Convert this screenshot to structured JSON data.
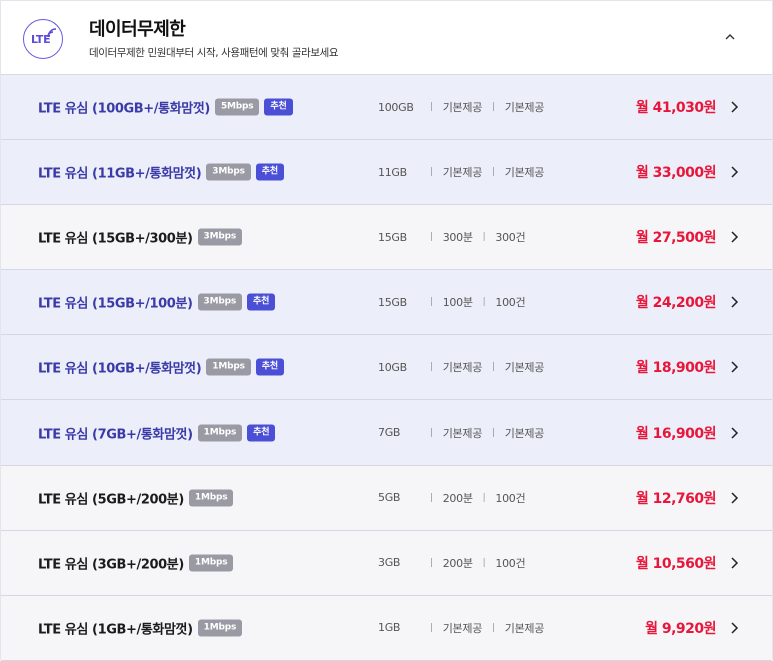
{
  "header": {
    "badge": "LTE",
    "title": "데이터무제한",
    "subtitle": "데이터무제한 민원대부터 시작, 사용패턴에 맞춰 골라보세요"
  },
  "colors": {
    "accent": "#4a4fd6",
    "price": "#e8163a",
    "highlight_row": "#eceff9",
    "plain_row": "#f6f6f9"
  },
  "plans": [
    {
      "name": "LTE 유심 (100GB+/통화맘껏)",
      "speed": "5Mbps",
      "badge": "추천",
      "data": "100GB",
      "voice": "기본제공",
      "sms": "기본제공",
      "price": "월 41,030원"
    },
    {
      "name": "LTE 유심 (11GB+/통화맘껏)",
      "speed": "3Mbps",
      "badge": "추천",
      "data": "11GB",
      "voice": "기본제공",
      "sms": "기본제공",
      "price": "월 33,000원"
    },
    {
      "name": "LTE 유심 (15GB+/300분)",
      "speed": "3Mbps",
      "badge": "",
      "data": "15GB",
      "voice": "300분",
      "sms": "300건",
      "price": "월 27,500원"
    },
    {
      "name": "LTE 유심 (15GB+/100분)",
      "speed": "3Mbps",
      "badge": "추천",
      "data": "15GB",
      "voice": "100분",
      "sms": "100건",
      "price": "월 24,200원"
    },
    {
      "name": "LTE 유심 (10GB+/통화맘껏)",
      "speed": "1Mbps",
      "badge": "추천",
      "data": "10GB",
      "voice": "기본제공",
      "sms": "기본제공",
      "price": "월 18,900원"
    },
    {
      "name": "LTE 유심 (7GB+/통화맘껏)",
      "speed": "1Mbps",
      "badge": "추천",
      "data": "7GB",
      "voice": "기본제공",
      "sms": "기본제공",
      "price": "월 16,900원"
    },
    {
      "name": "LTE 유심 (5GB+/200분)",
      "speed": "1Mbps",
      "badge": "",
      "data": "5GB",
      "voice": "200분",
      "sms": "100건",
      "price": "월 12,760원"
    },
    {
      "name": "LTE 유심 (3GB+/200분)",
      "speed": "1Mbps",
      "badge": "",
      "data": "3GB",
      "voice": "200분",
      "sms": "100건",
      "price": "월 10,560원"
    },
    {
      "name": "LTE 유심 (1GB+/통화맘껏)",
      "speed": "1Mbps",
      "badge": "",
      "data": "1GB",
      "voice": "기본제공",
      "sms": "기본제공",
      "price": "월 9,920원"
    }
  ]
}
